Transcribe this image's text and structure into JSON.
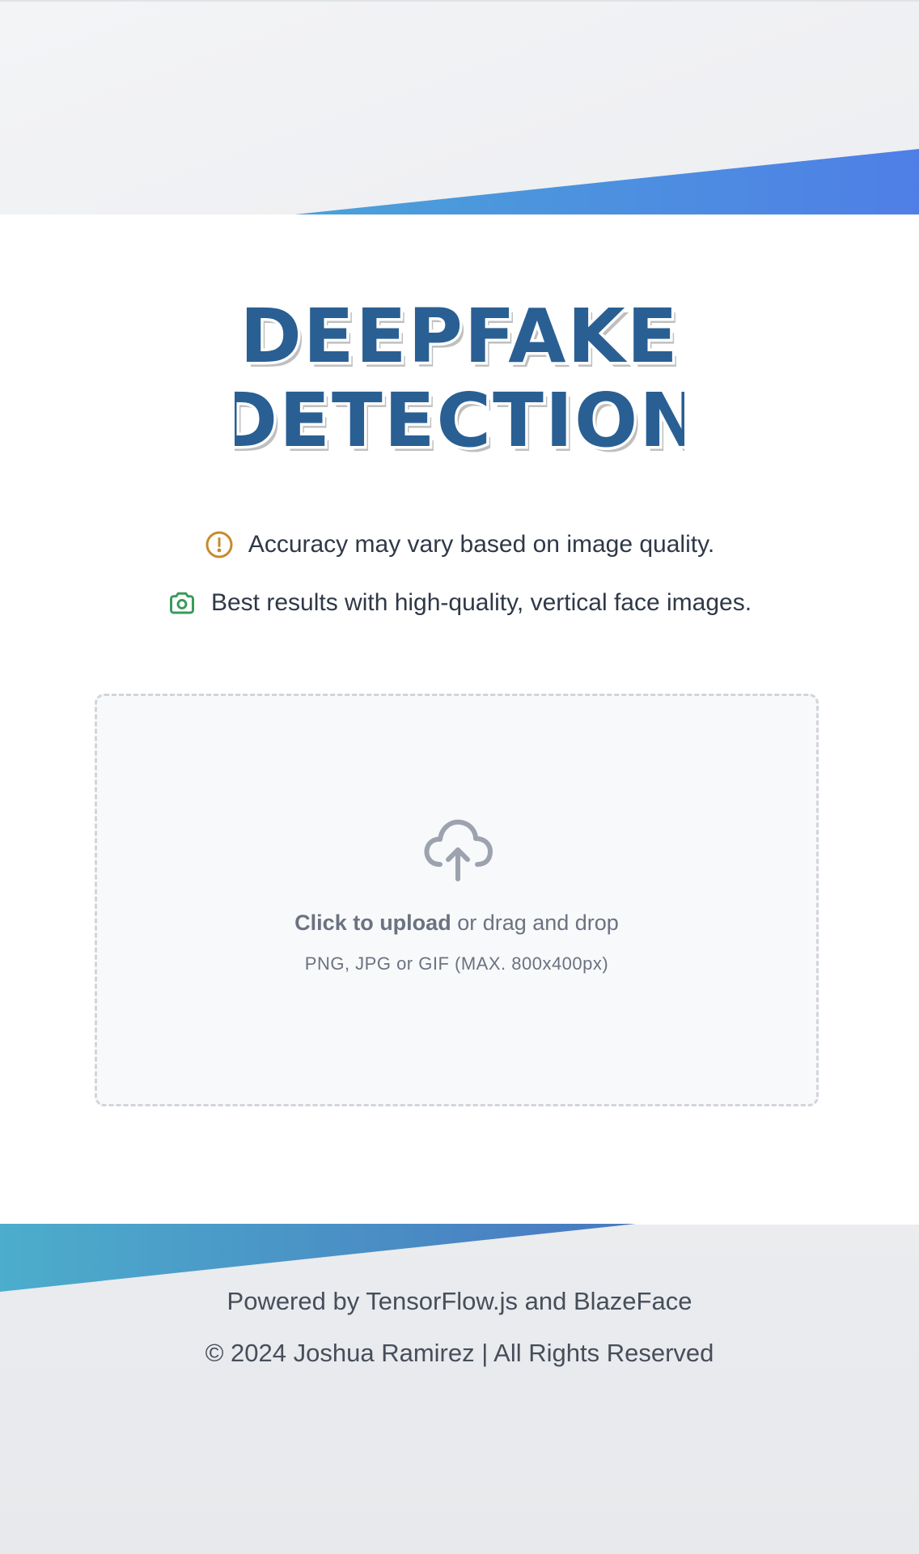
{
  "header": {
    "logo_line1": "DEEPFAKE",
    "logo_line2": "DETECTION",
    "logo_color": "#2a5f93",
    "banner_gradient": [
      "#4aa3d8",
      "#4f7fe6"
    ]
  },
  "notices": [
    {
      "icon": "alert-circle-icon",
      "icon_color": "#c98a2b",
      "text": "Accuracy may vary based on image quality."
    },
    {
      "icon": "camera-icon",
      "icon_color": "#3a9a5b",
      "text": "Best results with high-quality, vertical face images."
    }
  ],
  "upload": {
    "icon": "cloud-upload-icon",
    "action_label": "Click to upload",
    "action_suffix": " or drag and drop",
    "formats_hint": "PNG, JPG or GIF (MAX. 800x400px)"
  },
  "footer": {
    "powered_by": "Powered by TensorFlow.js and BlazeFace",
    "copyright": "© 2024 Joshua Ramirez | All Rights Reserved"
  }
}
